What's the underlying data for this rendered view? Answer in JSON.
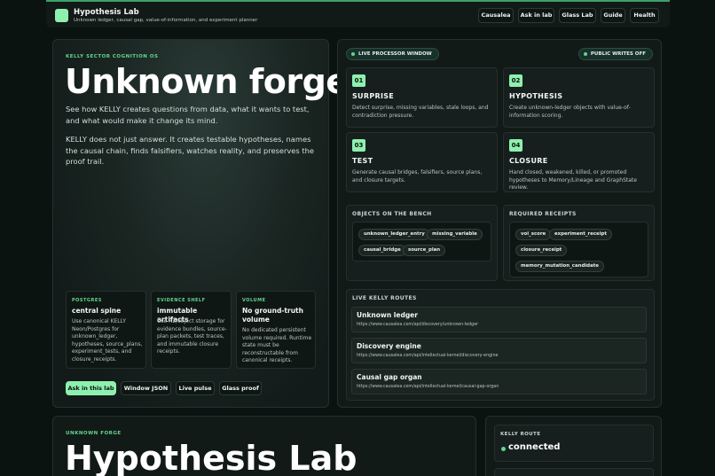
{
  "header": {
    "title": "Hypothesis Lab",
    "subtitle": "Unknown ledger, causal gap, value-of-information, and experiment planner",
    "nav": [
      "Causalea",
      "Ask in lab",
      "Glass Lab",
      "Guide",
      "Health"
    ]
  },
  "hero": {
    "eyebrow": "KELLY SECTOR COGNITION OS",
    "title": "Unknown forge",
    "p1": "See how KELLY creates questions from data, what it wants to test, and what would make it change its mind.",
    "p2": "KELLY does not just answer. It creates testable hypotheses, names the causal chain, finds falsifiers, watches reality, and preserves the proof trail.",
    "cards": [
      {
        "label": "POSTGRES",
        "title": "central spine",
        "text": "Use canonical KELLY Neon/Postgres for unknown_ledger, hypotheses, source_plans, experiment_tests, and closure_receipts."
      },
      {
        "label": "EVIDENCE SHELF",
        "title": "immutable artifacts",
        "text": "Use R2/object storage for evidence bundles, source-plan packets, test traces, and immutable closure receipts."
      },
      {
        "label": "VOLUME",
        "title": "No ground-truth volume",
        "text": "No dedicated persistent volume required. Runtime state must be reconstructable from canonical receipts."
      }
    ],
    "buttons": [
      "Ask in this lab",
      "Window JSON",
      "Live pulse",
      "Glass proof"
    ]
  },
  "processor": {
    "live_label": "LIVE PROCESSOR WINDOW",
    "writes_label": "PUBLIC WRITES OFF",
    "steps": [
      {
        "num": "01",
        "title": "SURPRISE",
        "text": "Detect surprise, missing variables, stale loops, and contradiction pressure."
      },
      {
        "num": "02",
        "title": "HYPOTHESIS",
        "text": "Create unknown-ledger objects with value-of-information scoring."
      },
      {
        "num": "03",
        "title": "TEST",
        "text": "Generate causal bridges, falsifiers, source plans, and closure targets."
      },
      {
        "num": "04",
        "title": "CLOSURE",
        "text": "Hand closed, weakened, killed, or promoted hypotheses to Memory/Lineage and GraphState review."
      }
    ],
    "bench_label": "OBJECTS ON THE BENCH",
    "bench": [
      "unknown_ledger_entry",
      "missing_variable",
      "causal_bridge",
      "source_plan"
    ],
    "receipts_label": "REQUIRED RECEIPTS",
    "receipts": [
      "voi_score",
      "experiment_receipt",
      "closure_receipt",
      "memory_mutation_candidate"
    ],
    "routes_label": "LIVE KELLY ROUTES",
    "routes": [
      {
        "name": "Unknown ledger",
        "url": "https://www.causalea.com/api/discovery/unknown-ledger"
      },
      {
        "name": "Discovery engine",
        "url": "https://www.causalea.com/api/intellectual-kernel/discovery-engine"
      },
      {
        "name": "Causal gap organ",
        "url": "https://www.causalea.com/api/intellectual-kernel/causal-gap-organ"
      }
    ]
  },
  "lower": {
    "eyebrow": "UNKNOWN FORGE",
    "title": "Hypothesis Lab",
    "route_label": "KELLY ROUTE",
    "route_status": "connected"
  }
}
